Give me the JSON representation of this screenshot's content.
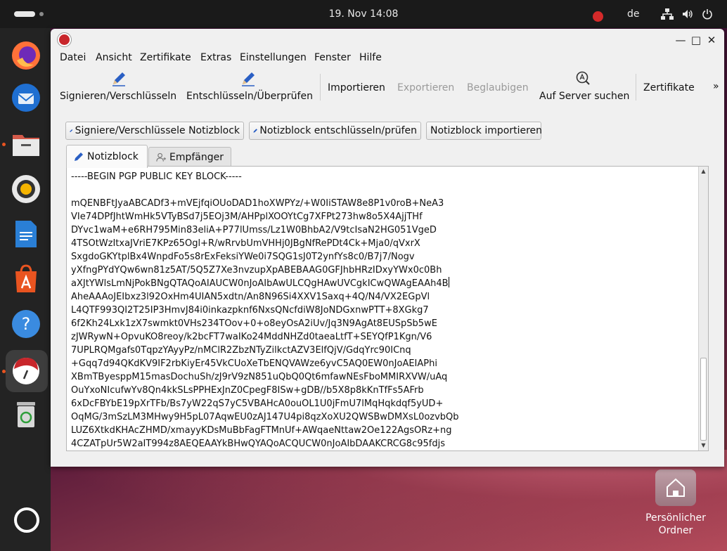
{
  "topbar": {
    "clock": "19. Nov  14:08",
    "language": "de"
  },
  "dock": {
    "items": [
      "firefox-icon",
      "thunderbird-icon",
      "files-icon",
      "rhythmbox-icon",
      "writer-icon",
      "app-center-icon",
      "help-icon",
      "kleopatra-icon",
      "trash-icon"
    ]
  },
  "desktop": {
    "home_label_1": "Persönlicher",
    "home_label_2": "Ordner"
  },
  "menubar": {
    "items": [
      "Datei",
      "Ansicht",
      "Zertifikate",
      "Extras",
      "Einstellungen",
      "Fenster",
      "Hilfe"
    ]
  },
  "toolbar": {
    "sign_encrypt": "Signieren/Verschlüsseln",
    "decrypt_verify": "Entschlüsseln/Überprüfen",
    "import": "Importieren",
    "export": "Exportieren",
    "certify": "Beglaubigen",
    "lookup_server": "Auf Server suchen",
    "certificates": "Zertifikate",
    "overflow": "»"
  },
  "notepad_buttons": {
    "sign_encrypt": "Signiere/Verschlüssele Notizblock",
    "decrypt_verify": "Notizblock entschlüsseln/prüfen",
    "import": "Notizblock importieren"
  },
  "tabs": {
    "notepad": "Notizblock",
    "recipients": "Empfänger"
  },
  "editor": {
    "lines": [
      "-----BEGIN PGP PUBLIC KEY BLOCK-----",
      "",
      "mQENBFtJyaABCADf3+mVEjfqiOUoDAD1hoXWPYz/+W0IiSTAW8e8P1v0roB+NeA3",
      "VIe74DPfJhtWmHk5VTyBSd7j5EOj3M/AHPplXOOYtCg7XFPt273hw8o5X4AjjTHf",
      "DYvc1waM+e6RH795Min83eliA+P77lUmss/Lz1W0BhbA2/V9tcIsaN2HG051VgeD",
      "4TSOtWzItxaJVriE7KPz65Ogl+R/wRrvbUmVHHj0JBgNfRePDt4Ck+Mja0/qVxrX",
      "SxgdoGKYtplBx4WnpdFo5s8rExFeksiYWe0i7SQG1sJ0T2ynfYs8c0/B7j7/Nogv",
      "yXfngPYdYQw6wn81z5AT/5Q5Z7Xe3nvzupXpABEBAAG0GFJhbHRzIDxyYWx0c0Bh",
      "aXJtYWlsLmNjPokBNgQTAQoAIAUCW0nJoAIbAwULCQgHAwUVCgkICwQWAgEAAh4B",
      "AheAAAoJEIbxz3l92OxHm4UIAN5xdtn/An8N96Si4XXV1Saxq+4Q/N4/VX2EGpVl",
      "L4QTF993QI2T25IP3HmvJ84i0inkazpknf6NxsQNcfdiW8JoNDGxnwPTT+8XGkg7",
      "6f2Kh24Lxk1zX7swmkt0VHs234TOov+0+o8eyOsA2iUv/Jq3N9AgAt8EUSpSb5wE",
      "zJWRywN+OpvuKO8reoy/k2bcFT7waIKo24MddNHZd0taeaLtfT+SEYQfP1Kgn/V6",
      "7UPLRQMgafs0TqpzYAyyPz/nMClR2ZbzNTyZilkctAZV3ElfQjV/GdqYrc90ICnq",
      "+Gqq7d94QKdKV9IF2rbKiyEr45VkCUoXeTbENQVAWze6yvC5AQ0EW0nJoAEIAPhi",
      "XBmTByesppM15masDochuSh/zJ9rV9zN851uQbQ0Qt6mfawNEsFboMMIRXVW/uAq",
      "OuYxoNIcufwYv8Qn4kkSLsPPHExJnZ0CpegF8ISw+gDB//b5X8p8kKnTfFs5AFrb",
      "6xDcFBYbE19pXrTFb/Bs7yW22qS7yC5VBAHcA0ouOL1U0jFmU7lMqHqkdqf5yUD+",
      "OqMG/3mSzLM3MHwy9H5pL07AqwEU0zAJ147U4pi8qzXoXU2QWSBwDMXsL0ozvbQb",
      "LUZ6XtkdKHAcZHMD/xmayyKDsMuBbFagFTMnUf+AWqaeNttaw2Oe122AgsORz+ng",
      "4CZATpUr5W2aIT994z8AEQEAAYkBHwQYAQoACQUCW0nJoAIbDAAKCRCG8c95fdjs"
    ]
  },
  "colors": {
    "accent": "#e95420",
    "kleopatra_red": "#c8262b",
    "pen_blue": "#2a5fc4"
  }
}
